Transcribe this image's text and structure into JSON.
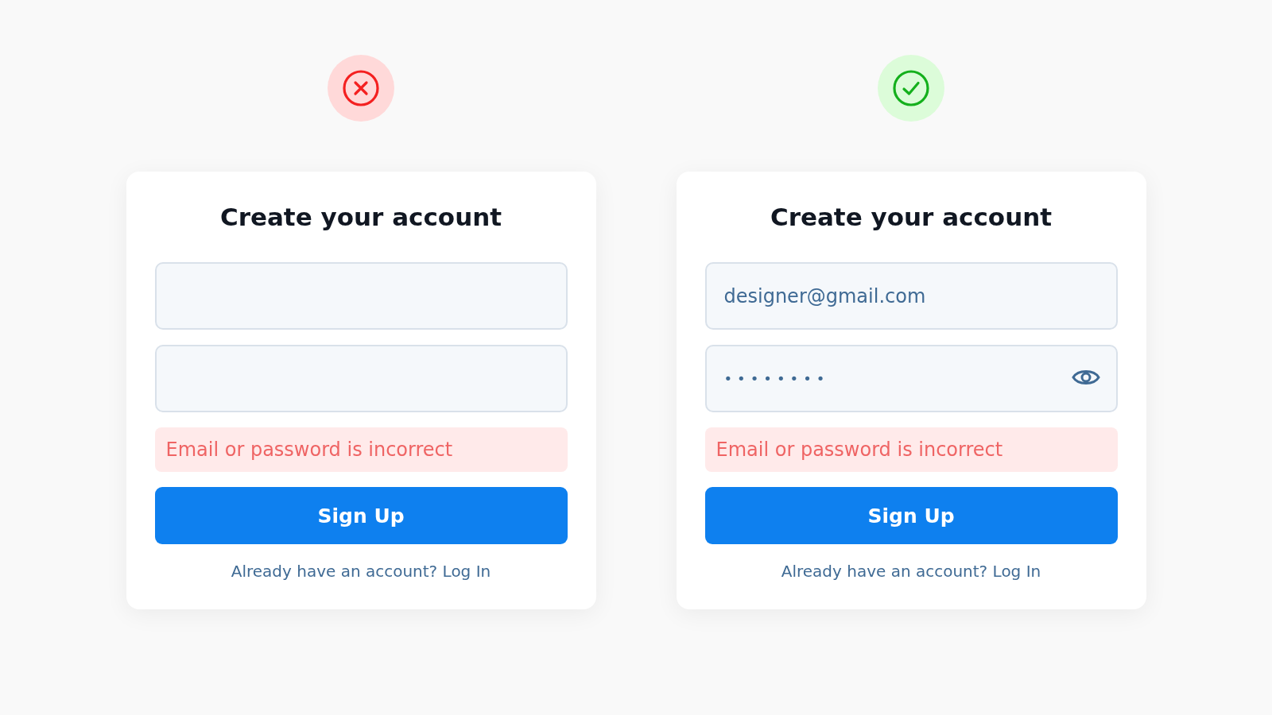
{
  "panels": [
    {
      "correct": false,
      "title": "Create your account",
      "fields": [
        {
          "kind": "email"
        },
        {
          "kind": "password",
          "reveal_toggle": false
        }
      ],
      "error": "Email or password is incorrect",
      "button": "Sign Up",
      "footer": "Already have an account? Log In"
    },
    {
      "correct": true,
      "title": "Create your account",
      "fields": [
        {
          "kind": "email",
          "value": "designer@gmail.com"
        },
        {
          "kind": "password",
          "value": "••••••••",
          "reveal_toggle": true
        }
      ],
      "error": "Email or password is incorrect",
      "button": "Sign Up",
      "footer": "Already have an account? Log In"
    }
  ]
}
